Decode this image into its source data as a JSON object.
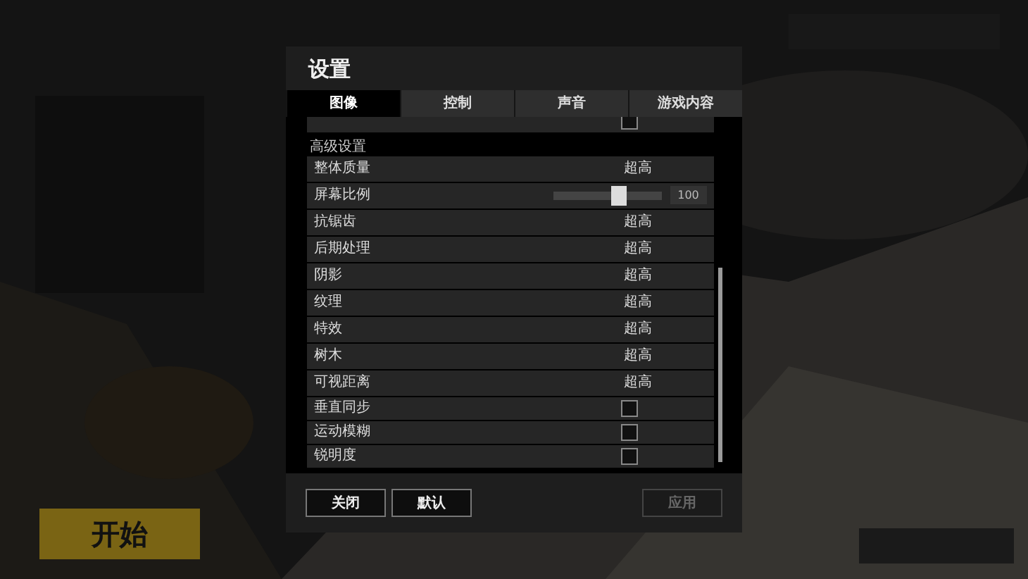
{
  "background": {
    "start_button": "开始"
  },
  "dialog": {
    "title": "设置",
    "tabs": [
      {
        "label": "图像",
        "selected": true
      },
      {
        "label": "控制",
        "selected": false
      },
      {
        "label": "声音",
        "selected": false
      },
      {
        "label": "游戏内容",
        "selected": false
      }
    ],
    "partial_row": {
      "checked": false
    },
    "section_heading": "高级设置",
    "rows": [
      {
        "kind": "select",
        "label": "整体质量",
        "value": "超高"
      },
      {
        "kind": "slider",
        "label": "屏幕比例",
        "level": 0.6,
        "value": "100"
      },
      {
        "kind": "select",
        "label": "抗锯齿",
        "value": "超高"
      },
      {
        "kind": "select",
        "label": "后期处理",
        "value": "超高"
      },
      {
        "kind": "select",
        "label": "阴影",
        "value": "超高"
      },
      {
        "kind": "select",
        "label": "纹理",
        "value": "超高"
      },
      {
        "kind": "select",
        "label": "特效",
        "value": "超高"
      },
      {
        "kind": "select",
        "label": "树木",
        "value": "超高"
      },
      {
        "kind": "select",
        "label": "可视距离",
        "value": "超高"
      },
      {
        "kind": "checkbox",
        "label": "垂直同步",
        "checked": false
      },
      {
        "kind": "checkbox",
        "label": "运动模糊",
        "checked": false
      },
      {
        "kind": "checkbox",
        "label": "锐明度",
        "checked": false
      }
    ],
    "buttons": [
      {
        "label": "关闭",
        "disabled": false
      },
      {
        "label": "默认",
        "disabled": false
      },
      {
        "label": "应用",
        "disabled": true
      }
    ]
  }
}
